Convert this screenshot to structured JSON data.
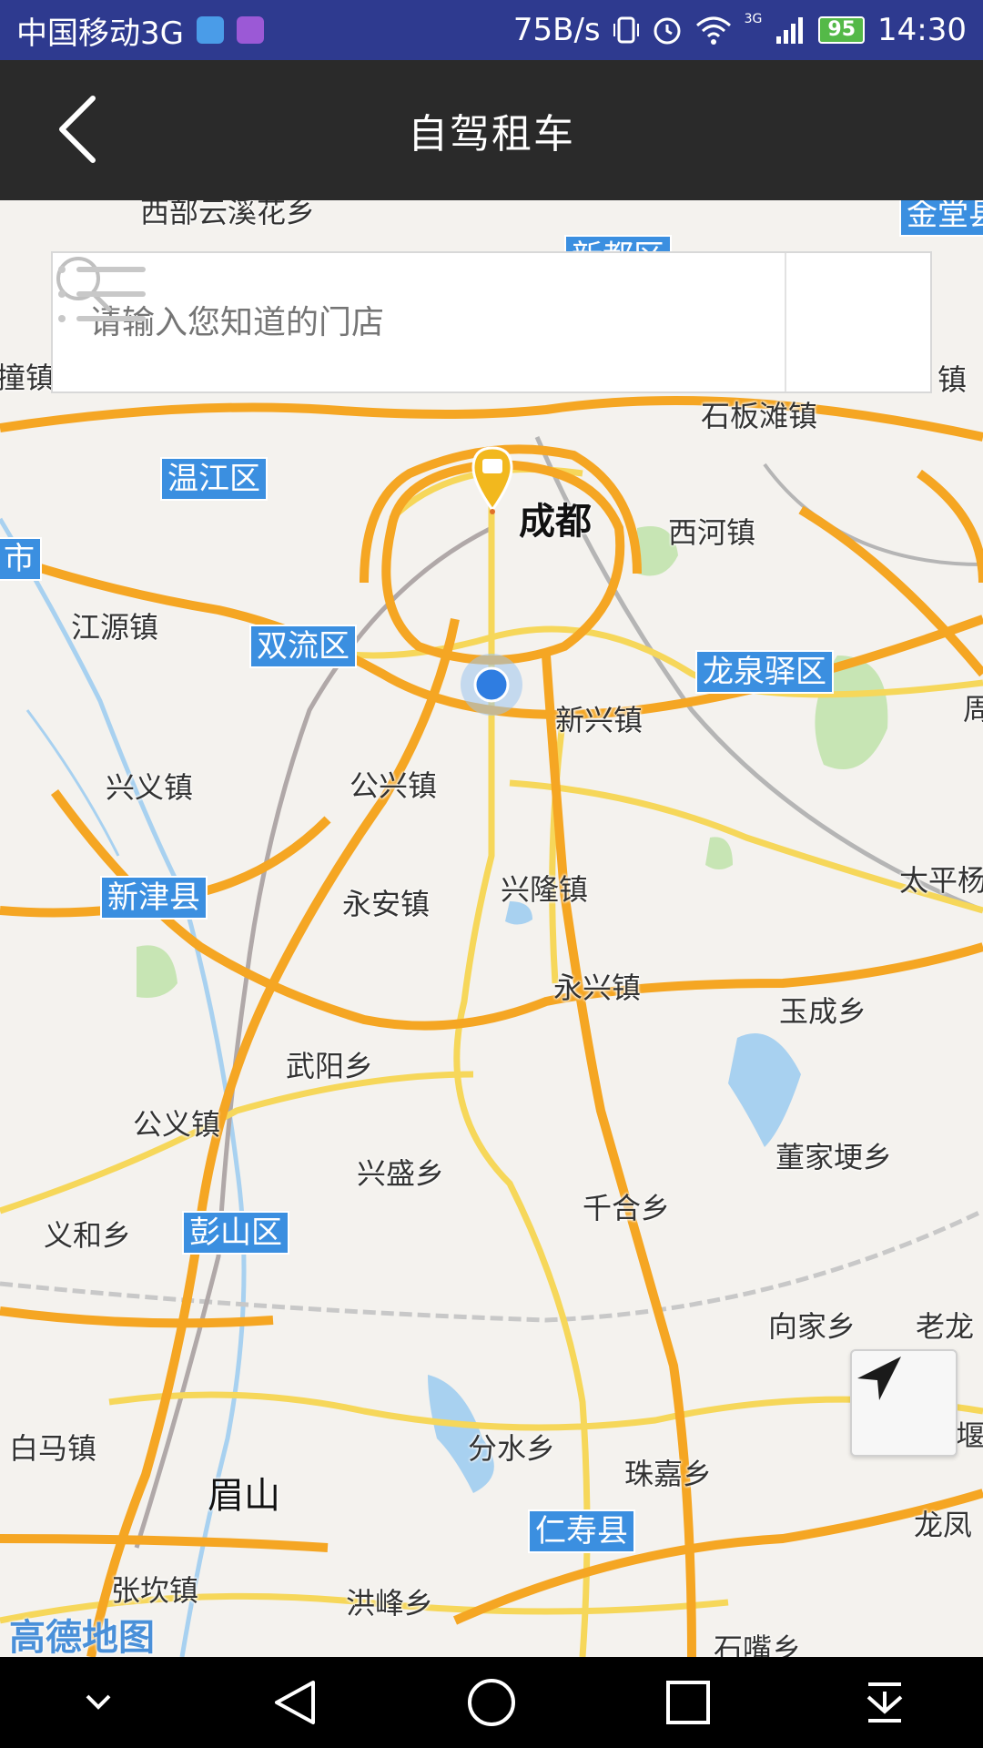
{
  "status_bar": {
    "carrier": "中国移动3G",
    "speed": "75B/s",
    "network": "3G",
    "battery": "95",
    "time": "14:30"
  },
  "header": {
    "title": "自驾租车",
    "back_icon": "chevron-left-icon"
  },
  "search": {
    "placeholder": "请输入您知道的门店",
    "icon": "search-icon",
    "list_icon": "list-icon"
  },
  "map": {
    "labels": {
      "chengdu": "成都",
      "meishan": "眉山",
      "wenjiang": "温江区",
      "shuangliu": "双流区",
      "longquanyi": "龙泉驿区",
      "xinjin": "新津县",
      "pengshan": "彭山区",
      "renshou": "仁寿县",
      "shibantan": "石板滩镇",
      "xihe": "西河镇",
      "jiangyuan": "江源镇",
      "xinxing": "新兴镇",
      "xingyi": "兴义镇",
      "gongxing": "公兴镇",
      "yongan": "永安镇",
      "xinglong": "兴隆镇",
      "taiping": "太平杨",
      "yongxing": "永兴镇",
      "yucheng": "玉成乡",
      "wuyang": "武阳乡",
      "gongyi": "公义镇",
      "dongjiageng": "董家埂乡",
      "xingsheng": "兴盛乡",
      "yihe": "义和乡",
      "qianhe": "千合乡",
      "xiangjia": "向家乡",
      "laolong": "老龙",
      "baima": "白马镇",
      "fenshui": "分水乡",
      "zhujia": "珠嘉乡",
      "longfeng": "龙凤",
      "zhangkan": "张坎镇",
      "hongfeng": "洪峰乡",
      "shizui": "石嘴乡",
      "left_town": "撞镇",
      "right_town": "镇",
      "left_city": "市",
      "top_left": "西部云溪花乡",
      "top_center": "新都区",
      "top_right": "金堂县",
      "right_zhou": "周",
      "right_yan": "堰"
    },
    "logo": "高德地图",
    "locate_icon": "navigation-arrow-icon"
  },
  "nav_bar": {
    "icons": [
      "chevron-down-icon",
      "back-triangle-icon",
      "home-circle-icon",
      "recents-square-icon",
      "download-icon"
    ]
  }
}
